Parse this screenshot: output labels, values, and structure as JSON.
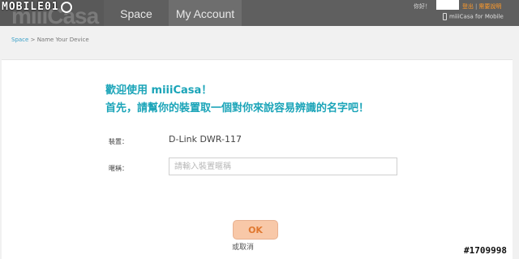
{
  "header": {
    "brand_text": "miiiCasa",
    "watermark": "MOBILE01",
    "tabs": [
      {
        "label": "Space"
      },
      {
        "label": "My Account"
      }
    ],
    "greeting": "你好！",
    "links": {
      "logout": "登出",
      "help": "需要說明"
    },
    "mobile_link": "miiiCasa for Mobile"
  },
  "breadcrumb": {
    "parent": "Space",
    "separator": ">",
    "current": "Name Your Device"
  },
  "main": {
    "welcome_line1": "歡迎使用 miiiCasa！",
    "welcome_line2": "首先，請幫你的裝置取一個對你來說容易辨識的名字吧！",
    "device_label": "裝置：",
    "device_value": "D-Link DWR-117",
    "nickname_label": "暱稱：",
    "nickname_placeholder": "請輸入裝置暱稱",
    "nickname_value": "",
    "ok_label": "OK",
    "cancel_label": "或取消"
  },
  "footer": {
    "post_id": "#1709998"
  },
  "colors": {
    "accent": "#1aa4b8",
    "ok_bg": "#f8c8a8",
    "ok_text": "#e07830",
    "link": "#ff9a2a"
  }
}
